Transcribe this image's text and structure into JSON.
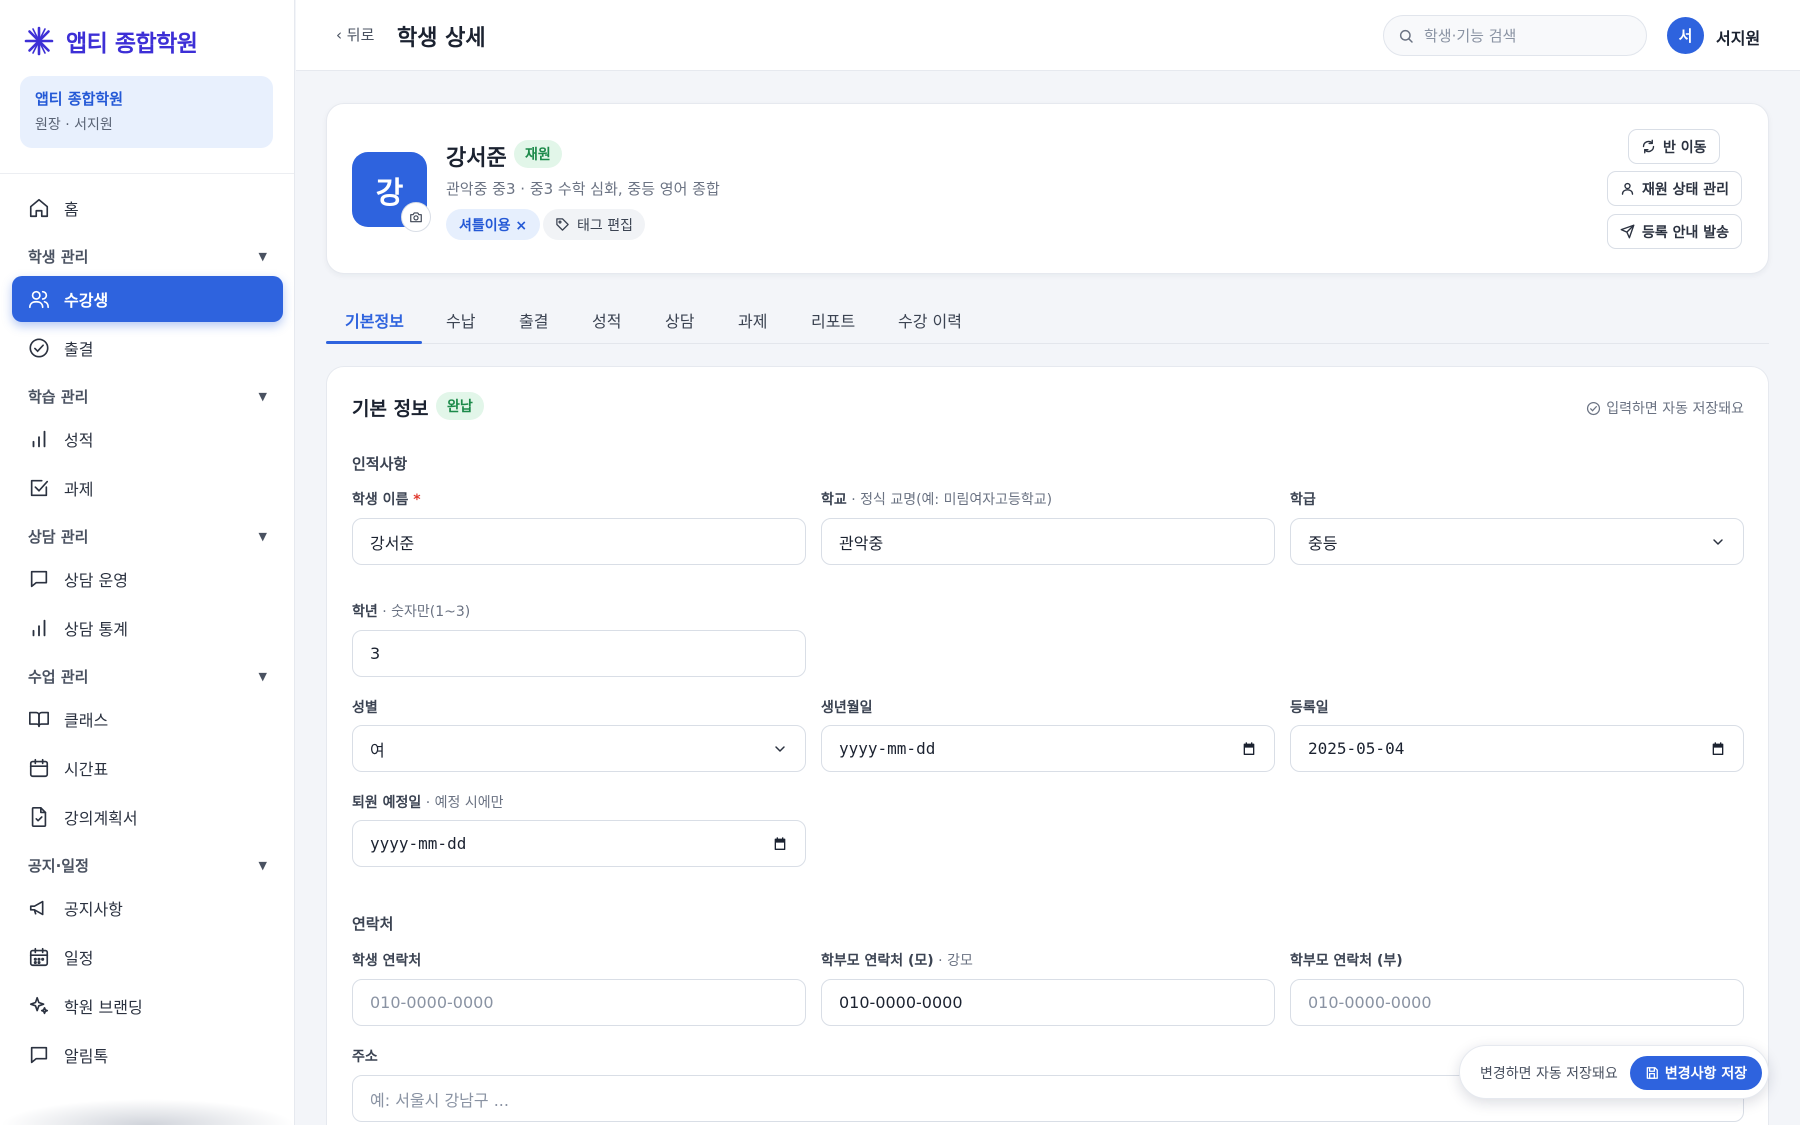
{
  "app": {
    "name": "앱티 종합학원"
  },
  "academy": {
    "name": "앱티 종합학원",
    "role": "원장 · 서지원"
  },
  "nav": {
    "home": "홈",
    "group_student": "학생 관리",
    "students": "수강생",
    "attendance": "출결",
    "group_learning": "학습 관리",
    "grades": "성적",
    "assignments": "과제",
    "group_counsel": "상담 관리",
    "counsel_ops": "상담 운영",
    "counsel_stats": "상담 통계",
    "group_class": "수업 관리",
    "classes": "클래스",
    "timetable": "시간표",
    "syllabus": "강의계획서",
    "group_notice": "공지·일정",
    "notices": "공지사항",
    "schedule": "일정",
    "branding": "학원 브랜딩",
    "alimtalk": "알림톡"
  },
  "header": {
    "back": "‹ 뒤로",
    "title": "학생 상세",
    "search_placeholder": "학생·기능 검색",
    "avatar_initial": "서",
    "user_name": "서지원"
  },
  "profile": {
    "initial": "강",
    "name": "강서준",
    "status": "재원",
    "subtitle": "관악중 중3 · 중3 수학 심화, 중등 영어 종합",
    "tag": "셔틀이용 ×",
    "tag_edit": "태그 편집",
    "actions": {
      "move_class": "반 이동",
      "manage_status": "재원 상태 관리",
      "send_enroll": "등록 안내 발송"
    }
  },
  "tabs": [
    "기본정보",
    "수납",
    "출결",
    "성적",
    "상담",
    "과제",
    "리포트",
    "수강 이력"
  ],
  "form": {
    "title": "기본 정보",
    "badge": "완납",
    "autosave": "입력하면 자동 저장돼요",
    "section_personal": "인적사항",
    "name_label": "학생 이름",
    "name_required": "*",
    "name_value": "강서준",
    "school_label": "학교",
    "school_hint": " · 정식 교명(예: 미림여자고등학교)",
    "school_value": "관악중",
    "level_label": "학급",
    "level_value": "중등",
    "grade_label": "학년",
    "grade_hint": " · 숫자만(1~3)",
    "grade_value": "3",
    "gender_label": "성별",
    "gender_value": "여",
    "birth_label": "생년월일",
    "birth_value": "yyyy-mm-dd",
    "enroll_label": "등록일",
    "enroll_value": "2025-05-04",
    "leave_label": "퇴원 예정일",
    "leave_hint": " · 예정 시에만",
    "leave_value": "yyyy-mm-dd",
    "section_contact": "연락처",
    "student_phone_label": "학생 연락처",
    "student_phone_placeholder": "010-0000-0000",
    "mother_phone_label": "학부모 연락처 (모)",
    "mother_phone_hint": " · 강모",
    "mother_phone_value": "010-0000-0000",
    "father_phone_label": "학부모 연락처 (부)",
    "father_phone_placeholder": "010-0000-0000",
    "address_label": "주소",
    "address_placeholder": "예: 서울시 강남구 ..."
  },
  "savebar": {
    "note": "변경하면 자동 저장돼요",
    "button": "변경사항 저장"
  },
  "colors": {
    "primary": "#2e63de",
    "logo": "#3d2fd6",
    "success_bg": "#e2f6e9",
    "success_text": "#1c8a4a"
  }
}
